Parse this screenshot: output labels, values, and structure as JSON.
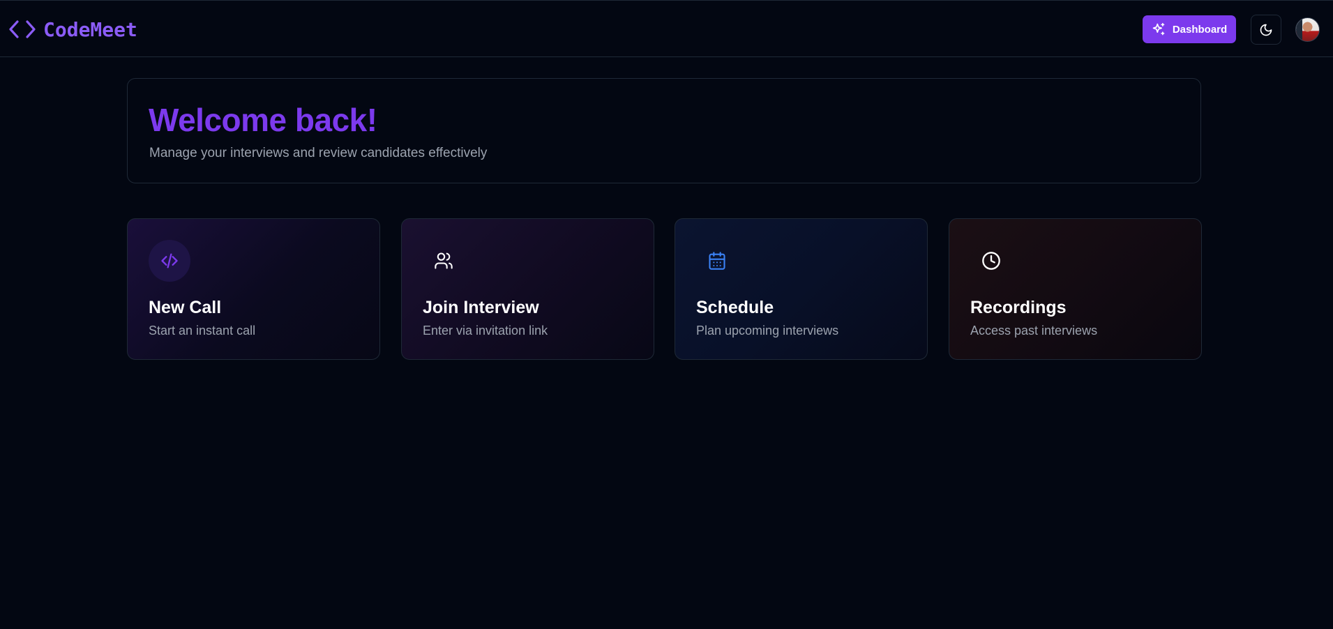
{
  "header": {
    "logo_text": "CodeMeet",
    "dashboard_label": "Dashboard"
  },
  "welcome": {
    "title": "Welcome back!",
    "subtitle": "Manage your interviews and review candidates effectively"
  },
  "actions": [
    {
      "title": "New Call",
      "description": "Start an instant call",
      "icon": "code-icon"
    },
    {
      "title": "Join Interview",
      "description": "Enter via invitation link",
      "icon": "users-icon"
    },
    {
      "title": "Schedule",
      "description": "Plan upcoming interviews",
      "icon": "calendar-icon"
    },
    {
      "title": "Recordings",
      "description": "Access past interviews",
      "icon": "clock-icon"
    }
  ],
  "colors": {
    "background": "#030712",
    "accent": "#7c3aed",
    "brand_text": "#8b5cf6",
    "schedule_icon": "#3b82f6",
    "muted_text": "#9ca3af"
  }
}
